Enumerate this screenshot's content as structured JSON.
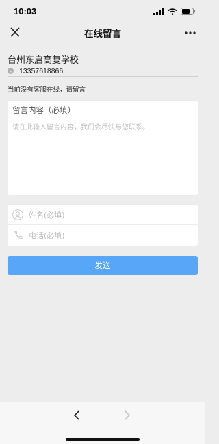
{
  "status_bar": {
    "time": "10:03"
  },
  "nav": {
    "title": "在线留言",
    "close_icon": "close-icon",
    "more_icon": "more-icon"
  },
  "info": {
    "school_name": "台州东启高复学校",
    "phone": "13357618866",
    "notice": "当前没有客服在线，请留言"
  },
  "message": {
    "title": "留言内容（必填）",
    "placeholder": "请在此输入留言内容，我们会尽快与您联系。"
  },
  "contact": {
    "name_placeholder": "姓名(必填)",
    "phone_placeholder": "电话(必填)"
  },
  "submit_label": "发送",
  "colors": {
    "accent": "#58a6f7",
    "background": "#ededed"
  }
}
